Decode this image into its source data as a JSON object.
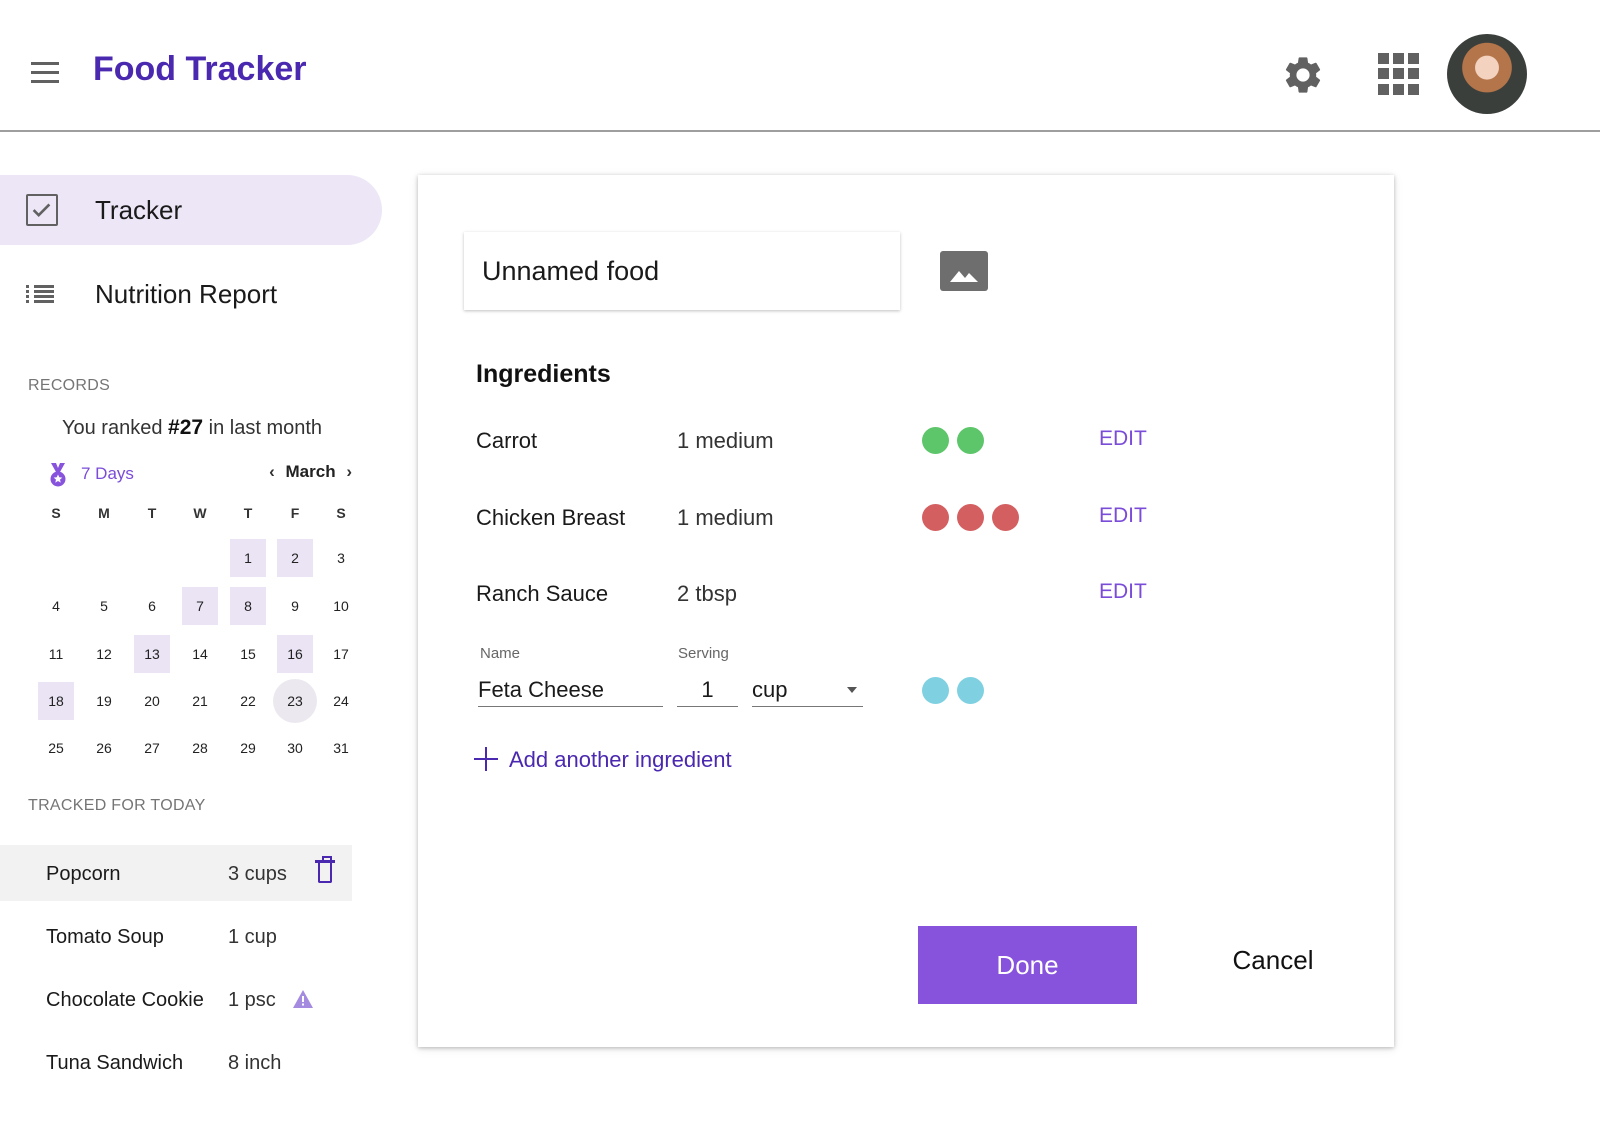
{
  "header": {
    "title": "Food Tracker",
    "menu_icon": "hamburger-menu-icon",
    "settings_icon": "gear-icon",
    "apps_icon": "apps-grid-icon",
    "avatar_icon": "user-avatar"
  },
  "sidebar": {
    "nav": [
      {
        "label": "Tracker",
        "icon": "checkbox-icon",
        "active": true
      },
      {
        "label": "Nutrition Report",
        "icon": "list-icon",
        "active": false
      }
    ],
    "records_label": "RECORDS",
    "rank": {
      "prefix": "You ranked",
      "value": "#27",
      "suffix": "in last month"
    },
    "calendar": {
      "streak_label": "7 Days",
      "month": "March",
      "weekdays": [
        "S",
        "M",
        "T",
        "W",
        "T",
        "F",
        "S"
      ],
      "weeks": [
        [
          "",
          "",
          "",
          "",
          "1",
          "2",
          "3"
        ],
        [
          "4",
          "5",
          "6",
          "7",
          "8",
          "9",
          "10"
        ],
        [
          "11",
          "12",
          "13",
          "14",
          "15",
          "16",
          "17"
        ],
        [
          "18",
          "19",
          "20",
          "21",
          "22",
          "23",
          "24"
        ],
        [
          "25",
          "26",
          "27",
          "28",
          "29",
          "30",
          "31"
        ]
      ],
      "highlighted_days": [
        "1",
        "2",
        "7",
        "8",
        "13",
        "16",
        "18"
      ],
      "today": "23"
    },
    "tracked_label": "TRACKED FOR TODAY",
    "tracked": [
      {
        "name": "Popcorn",
        "qty": "3 cups",
        "icon": "trash-icon",
        "selected": true
      },
      {
        "name": "Tomato Soup",
        "qty": "1 cup",
        "icon": "",
        "selected": false
      },
      {
        "name": "Chocolate Cookie",
        "qty": "1 psc",
        "icon": "warning-icon",
        "selected": false
      },
      {
        "name": "Tuna Sandwich",
        "qty": "8 inch",
        "icon": "",
        "selected": false
      }
    ]
  },
  "card": {
    "food_name": "Unnamed food",
    "image_icon": "image-icon",
    "ingredients_title": "Ingredients",
    "ingredients": [
      {
        "name": "Carrot",
        "serving": "1 medium",
        "dot_color": "#5dc56a",
        "dots": 2,
        "edit_label": "EDIT"
      },
      {
        "name": "Chicken Breast",
        "serving": "1 medium",
        "dot_color": "#d45f61",
        "dots": 3,
        "edit_label": "EDIT"
      },
      {
        "name": "Ranch Sauce",
        "serving": "2 tbsp",
        "dot_color": "",
        "dots": 0,
        "edit_label": "EDIT"
      }
    ],
    "new_ingredient": {
      "name_label": "Name",
      "serving_label": "Serving",
      "name_value": "Feta Cheese",
      "qty_value": "1",
      "unit_value": "cup",
      "dot_color": "#7fd1e1",
      "dots": 2
    },
    "add_label": "Add another ingredient",
    "done_label": "Done",
    "cancel_label": "Cancel"
  },
  "colors": {
    "brand": "#4a28b0",
    "accent": "#8753dd",
    "active_nav": "#ece6f6"
  }
}
